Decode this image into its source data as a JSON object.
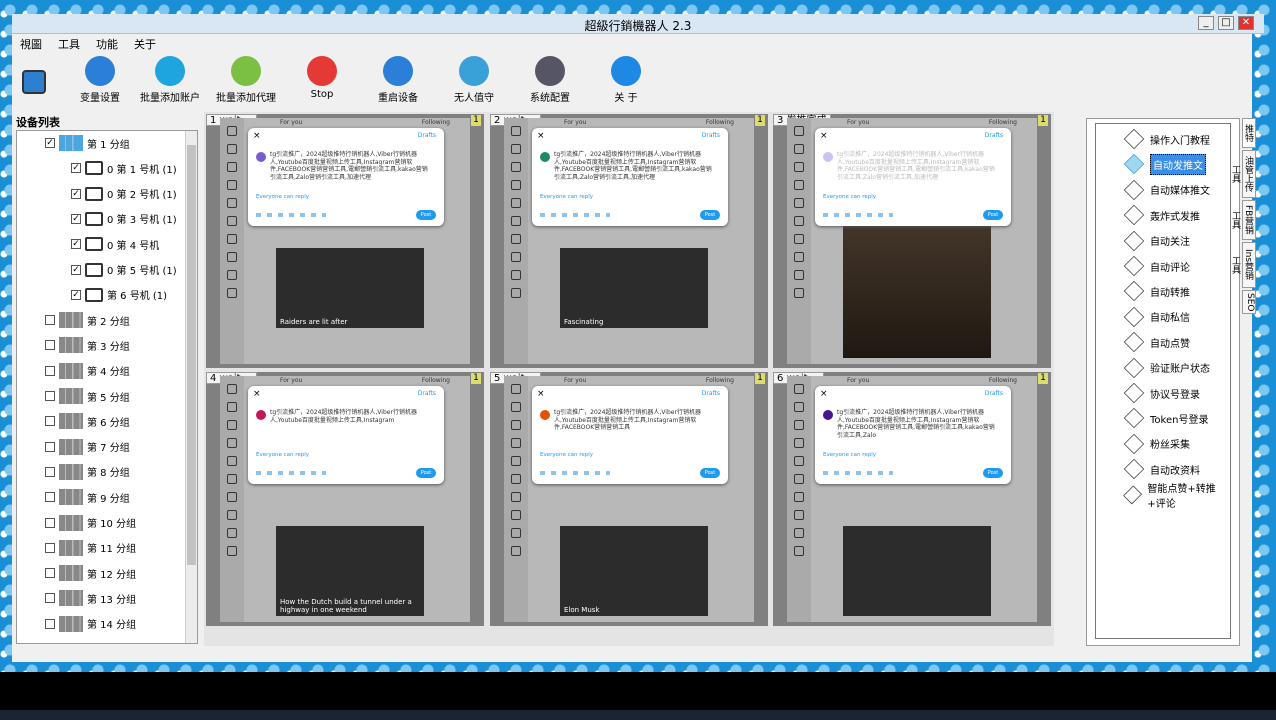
{
  "window": {
    "title": "超級行銷機器人 2.3"
  },
  "menu": [
    "視圖",
    "工具",
    "功能",
    "关于"
  ],
  "toolbar": [
    {
      "label": "变量设置",
      "icon": "variable-settings-icon",
      "color": "#2b7fd8"
    },
    {
      "label": "批量添加账户",
      "icon": "add-account-icon",
      "color": "#1ea5e0"
    },
    {
      "label": "批量添加代理",
      "icon": "add-proxy-icon",
      "color": "#7bc043"
    },
    {
      "label": "Stop",
      "icon": "stop-icon",
      "color": "#e53935"
    },
    {
      "label": "重启设备",
      "icon": "restart-icon",
      "color": "#2b7fd8"
    },
    {
      "label": "无人值守",
      "icon": "unattended-icon",
      "color": "#3aa0d8"
    },
    {
      "label": "系统配置",
      "icon": "gear-icon",
      "color": "#556"
    },
    {
      "label": "关 于",
      "icon": "info-icon",
      "color": "#1e88e5"
    }
  ],
  "device_list": {
    "title": "设备列表",
    "groups": [
      "第 1 分组",
      "第 2 分组",
      "第 3 分组",
      "第 4 分组",
      "第 5 分组",
      "第 6 分组",
      "第 7 分组",
      "第 8 分组",
      "第 9 分组",
      "第 10 分组",
      "第 11 分组",
      "第 12 分组",
      "第 13 分组",
      "第 14 分组"
    ],
    "devices": [
      "0 第 1 号机 (1)",
      "0 第 2 号机 (1)",
      "0 第 3 号机 (1)",
      "0 第 4 号机",
      "0 第 5 号机 (1)",
      "第 6 号机 (1)"
    ]
  },
  "phones": [
    {
      "label": "1 wait ...",
      "badge": "1",
      "avatar": "#7a5ccf",
      "avatar_letter": "C",
      "text": "tg引流推广，2024超级推特行销机器人,Viber行销机器人,Youtube百度批量视频上传工具,Instagram营销软件,FACEBOOK营销营销工具,電郵營銷引流工具,kakao营销引流工具,Zalo营销引流工具,加速代理",
      "dark_text": false,
      "media": "Raiders are lit after"
    },
    {
      "label": "2 wait ...",
      "badge": "1",
      "avatar": "#1e8a6a",
      "avatar_letter": "W",
      "text": "tg引流推广，2024超级推特行销机器人,Viber行销机器人,Youtube百度批量视频上传工具,Instagram营销软件,FACEBOOK营销营销工具,電郵營銷引流工具,kakao营销引流工具,Zalo营销引流工具,加速代理",
      "dark_text": false,
      "media": "Fascinating"
    },
    {
      "label": "3 发推完成",
      "badge": "1",
      "avatar": "#c9c3ef",
      "avatar_letter": "C",
      "text": "tg引流推广，2024超级推特行销机器人,Viber行销机器人,Youtube百度批量视频上传工具,Instagram营销软件,FACEBOOK营销营销工具,電郵營銷引流工具,kakao营销引流工具,Zalo营销引流工具,加速代理",
      "dark_text": true,
      "media": ""
    },
    {
      "label": "4 wait ...",
      "badge": "1",
      "avatar": "#c2185b",
      "avatar_letter": "W",
      "text": "tg引流推广，2024超级推特行销机器人,Viber行销机器人,Youtube百度批量视频上传工具,Instagram",
      "dark_text": false,
      "media": "How the Dutch build a tunnel under a highway in one weekend"
    },
    {
      "label": "5 wait ...",
      "badge": "1",
      "avatar": "#e65100",
      "avatar_letter": "R",
      "text": "tg引流推广，2024超级推特行销机器人,Viber行销机器人,Youtube百度批量视频上传工具,Instagram营销软件,FACEBOOK营销营销工具",
      "dark_text": false,
      "media": "Elon Musk"
    },
    {
      "label": "6 wait ...",
      "badge": "1",
      "avatar": "#4a148c",
      "avatar_letter": "K",
      "text": "tg引流推广，2024超级推特行销机器人,Viber行销机器人,Youtube百度批量视频上传工具,Instagram营销软件,FACEBOOK营销营销工具,電郵營銷引流工具,kakao营销引流工具,Zalo",
      "dark_text": false,
      "media": ""
    }
  ],
  "tweet_ui": {
    "drafts": "Drafts",
    "everyone": "Everyone can reply",
    "post": "Post",
    "for_you": "For you",
    "following": "Following",
    "close": "×"
  },
  "right_panel": {
    "items": [
      "操作入门教程",
      "自动发推文",
      "自动媒体推文",
      "轰炸式发推",
      "自动关注",
      "自动评论",
      "自动转推",
      "自动私信",
      "自动点赞",
      "验证账户状态",
      "协议号登录",
      "Token号登录",
      "粉丝采集",
      "自动改资料",
      "智能点赞+转推+评论"
    ],
    "selected": 1
  },
  "right_tabs": [
    "推特",
    "油管上传工具",
    "FB营销工具",
    "Ins营销工具",
    "SEO"
  ]
}
